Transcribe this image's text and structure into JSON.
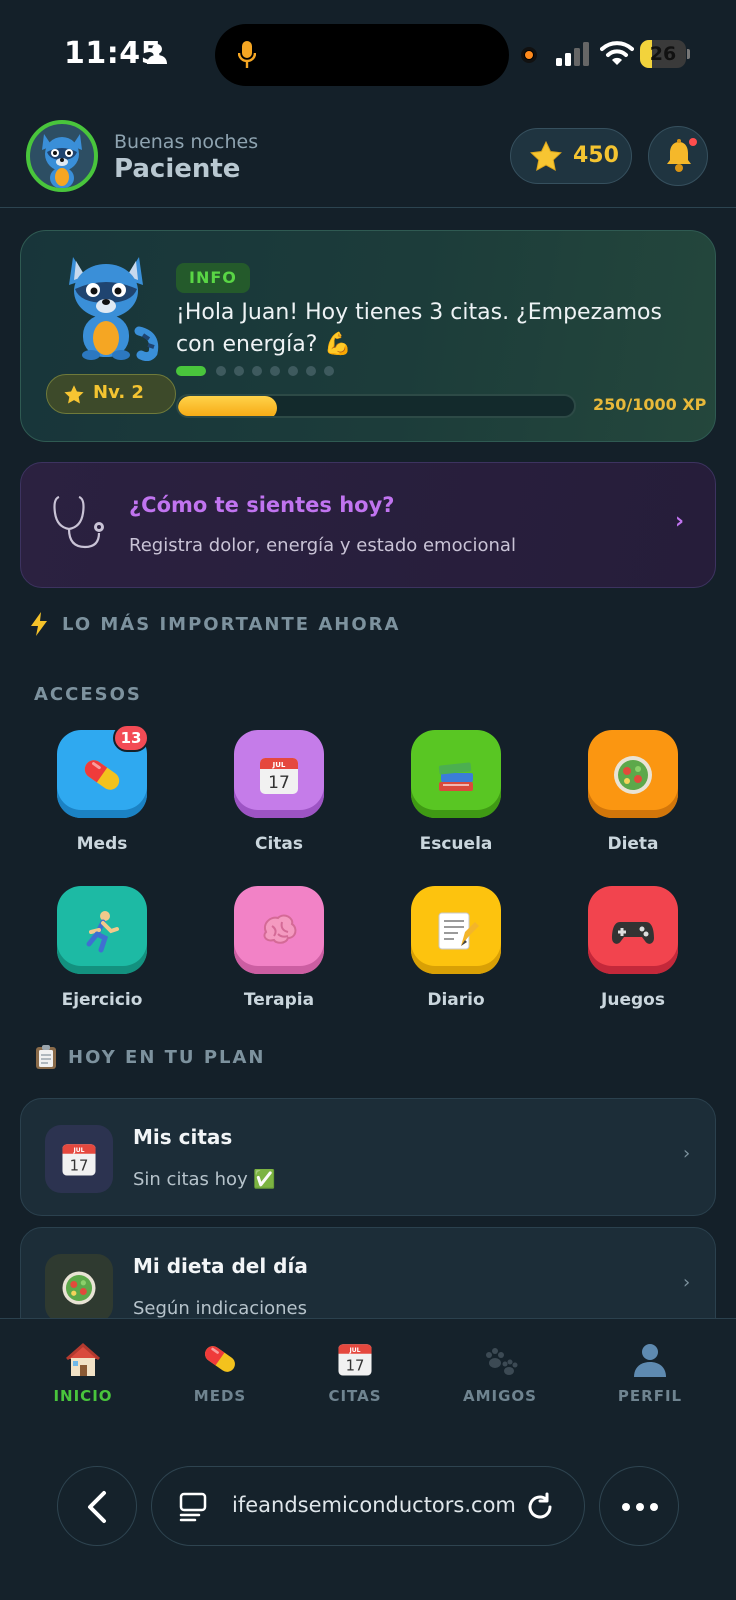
{
  "status_bar": {
    "time": "11:45",
    "battery": "26"
  },
  "header": {
    "greeting": "Buenas noches",
    "user": "Paciente",
    "points": "450"
  },
  "info_card": {
    "badge": "INFO",
    "message": "¡Hola Juan! Hoy tienes 3 citas. ¿Empezamos con energía? 💪",
    "level": "Nv. 2",
    "xp_label": "250/1000 XP",
    "xp_current": 250,
    "xp_max": 1000,
    "carousel_total": 8,
    "carousel_active": 0
  },
  "feel_card": {
    "title": "¿Cómo te sientes hoy?",
    "subtitle": "Registra dolor, energía y estado emocional"
  },
  "sections": {
    "important": "LO MÁS IMPORTANTE AHORA",
    "accesos": "ACCESOS",
    "plan": "HOY EN TU PLAN"
  },
  "accesos": [
    {
      "label": "Meds",
      "badge": "13",
      "color": "#2fa9f0",
      "shade": "#1b82c4",
      "icon": "pill-icon"
    },
    {
      "label": "Citas",
      "badge": "",
      "color": "#c57ce9",
      "shade": "#9d54c4",
      "icon": "calendar-icon"
    },
    {
      "label": "Escuela",
      "badge": "",
      "color": "#59c623",
      "shade": "#3f9a14",
      "icon": "books-icon"
    },
    {
      "label": "Dieta",
      "badge": "",
      "color": "#fb9611",
      "shade": "#d2760a",
      "icon": "salad-icon"
    },
    {
      "label": "Ejercicio",
      "badge": "",
      "color": "#1dbaa4",
      "shade": "#13917f",
      "icon": "runner-icon"
    },
    {
      "label": "Terapia",
      "badge": "",
      "color": "#f282c6",
      "shade": "#cc5ea2",
      "icon": "brain-icon"
    },
    {
      "label": "Diario",
      "badge": "",
      "color": "#fdc30e",
      "shade": "#d9a005",
      "icon": "memo-icon"
    },
    {
      "label": "Juegos",
      "badge": "",
      "color": "#f2444e",
      "shade": "#c4283a",
      "icon": "gamepad-icon"
    }
  ],
  "plan": [
    {
      "title": "Mis citas",
      "subtitle": "Sin citas hoy ✅",
      "icon": "calendar-icon",
      "box": "#2c3350"
    },
    {
      "title": "Mi dieta del día",
      "subtitle": "Según indicaciones",
      "icon": "salad-icon",
      "box": "#2f3a30"
    }
  ],
  "nav": [
    {
      "label": "INICIO",
      "icon": "home-icon",
      "active": true
    },
    {
      "label": "MEDS",
      "icon": "pill-icon",
      "active": false
    },
    {
      "label": "CITAS",
      "icon": "calendar-icon",
      "active": false
    },
    {
      "label": "AMIGOS",
      "icon": "paws-icon",
      "active": false
    },
    {
      "label": "PERFIL",
      "icon": "profile-icon",
      "active": false
    }
  ],
  "browser": {
    "url": "ifeandsemiconductors.com"
  },
  "colors": {
    "accent_green": "#49c53c",
    "star_gold": "#f4c431",
    "purple": "#c174f0",
    "background": "#142029"
  }
}
